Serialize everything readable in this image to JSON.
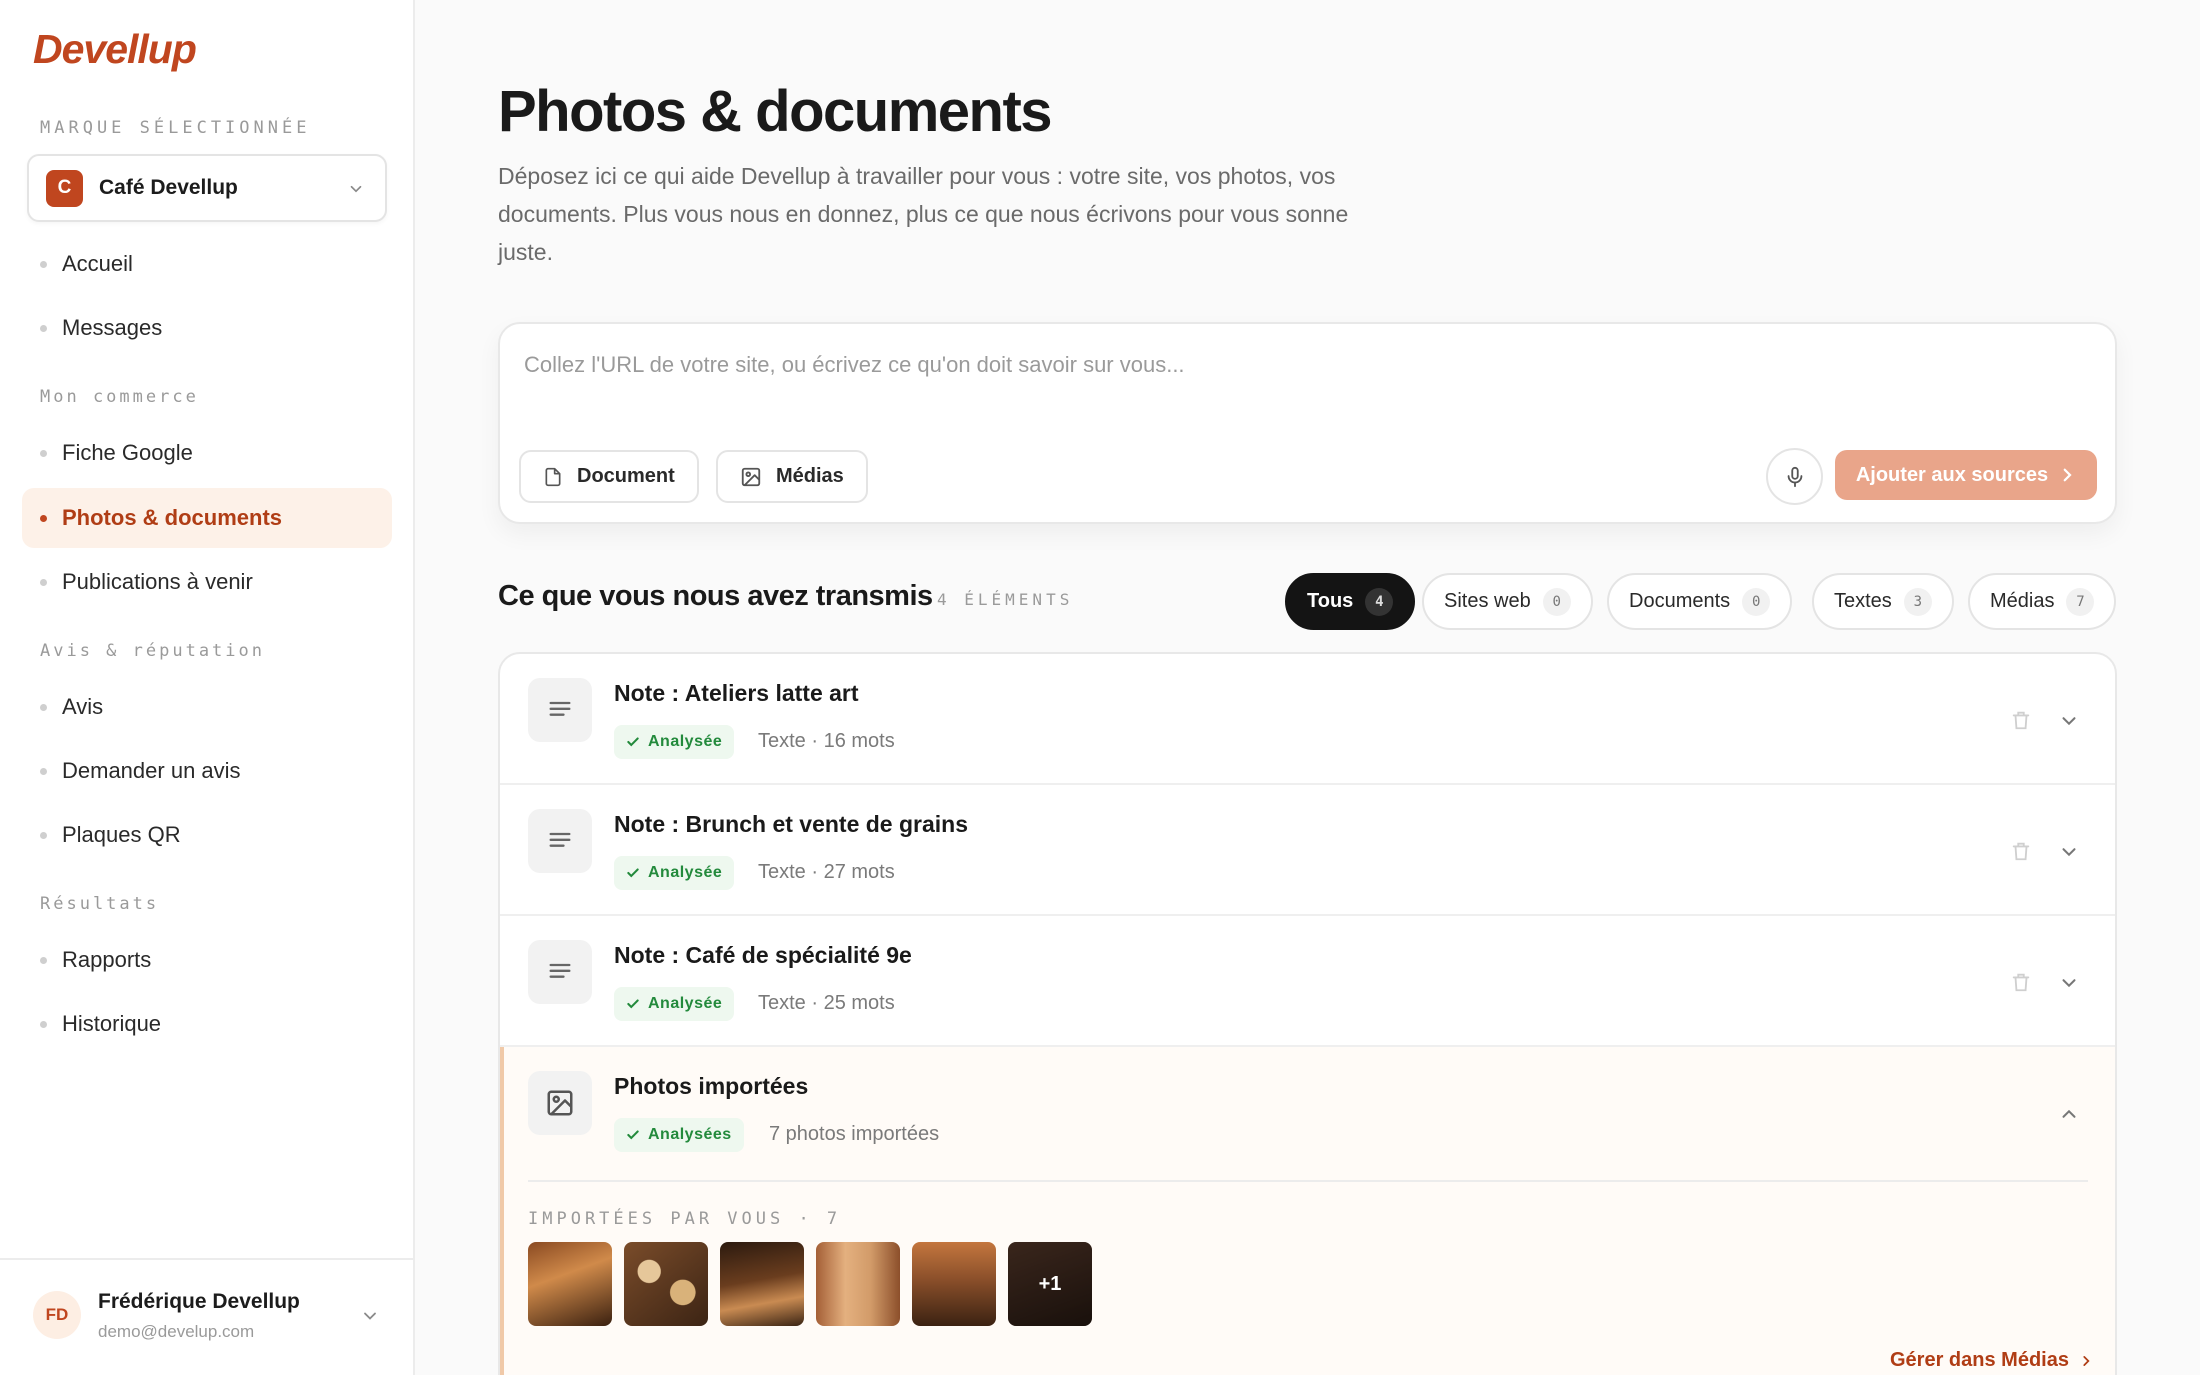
{
  "sidebar": {
    "logo": "Devellup",
    "brand_label": "MARQUE SÉLECTIONNÉE",
    "brand": {
      "initial": "C",
      "name": "Café Devellup"
    },
    "sections": [
      {
        "label": "",
        "items": [
          "Accueil",
          "Messages"
        ]
      },
      {
        "label": "Mon commerce",
        "items": [
          "Fiche Google",
          "Photos & documents",
          "Publications à venir"
        ]
      },
      {
        "label": "Avis & réputation",
        "items": [
          "Avis",
          "Demander un avis",
          "Plaques QR"
        ]
      },
      {
        "label": "Résultats",
        "items": [
          "Rapports",
          "Historique"
        ]
      }
    ],
    "active_item": "Photos & documents",
    "user": {
      "initials": "FD",
      "name": "Frédérique Devellup",
      "email": "demo@develup.com"
    }
  },
  "header": {
    "title": "Photos & documents",
    "description": "Déposez ici ce qui aide Devellup à travailler pour vous : votre site, vos photos, vos documents. Plus vous nous en donnez, plus ce que nous écrivons pour vous sonne juste."
  },
  "composer": {
    "placeholder": "Collez l'URL de votre site, ou écrivez ce qu'on doit savoir sur vous...",
    "document_button": "Document",
    "media_button": "Médias",
    "submit_button": "Ajouter aux sources"
  },
  "list": {
    "title": "Ce que vous nous avez transmis",
    "count_label": "4 ÉLÉMENTS",
    "filters": [
      {
        "label": "Tous",
        "count": "4",
        "active": true
      },
      {
        "label": "Sites web",
        "count": "0",
        "active": false
      },
      {
        "label": "Documents",
        "count": "0",
        "active": false
      },
      {
        "label": "Textes",
        "count": "3",
        "active": false
      },
      {
        "label": "Médias",
        "count": "7",
        "active": false
      }
    ],
    "items": [
      {
        "title": "Note : Ateliers latte art",
        "status": "Analysée",
        "meta": "Texte · 16 mots",
        "icon": "text-lines-icon"
      },
      {
        "title": "Note : Brunch et vente de grains",
        "status": "Analysée",
        "meta": "Texte · 27 mots",
        "icon": "text-lines-icon"
      },
      {
        "title": "Note : Café de spécialité 9e",
        "status": "Analysée",
        "meta": "Texte · 25 mots",
        "icon": "text-lines-icon"
      },
      {
        "title": "Photos importées",
        "status": "Analysées",
        "meta": "7 photos importées",
        "icon": "image-icon"
      }
    ],
    "expanded": {
      "sub_label": "IMPORTÉES PAR VOUS · 7",
      "more_label": "+1",
      "manage_link": "Gérer dans Médias"
    }
  },
  "colors": {
    "accent": "#c0461f",
    "accent_light": "#e9a58a",
    "success": "#238a3c",
    "active_nav_bg": "#fdf1e8"
  }
}
